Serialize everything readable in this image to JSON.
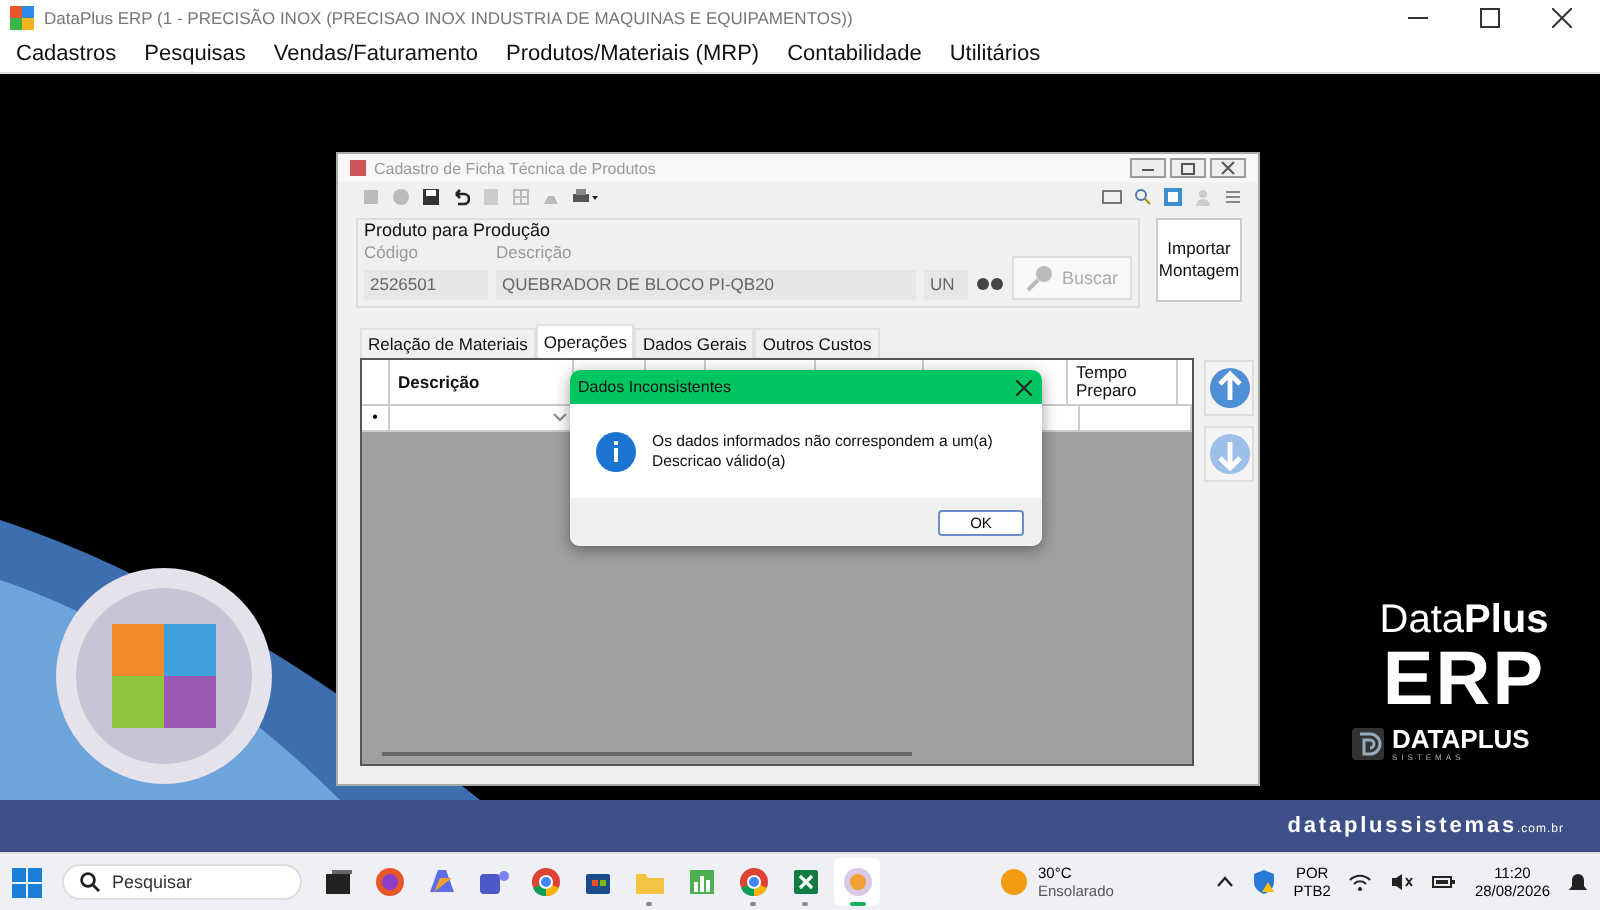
{
  "app_window": {
    "title": "DataPlus ERP (1 - PRECISÃO INOX  (PRECISAO INOX INDUSTRIA DE MAQUINAS E EQUIPAMENTOS))"
  },
  "menu": [
    "Cadastros",
    "Pesquisas",
    "Vendas/Faturamento",
    "Produtos/Materiais (MRP)",
    "Contabilidade",
    "Utilitários"
  ],
  "child_window": {
    "title": "Cadastro de Ficha Técnica de Produtos",
    "group_title": "Produto para Produção",
    "fields": [
      {
        "label": "Código",
        "value": "2526501"
      },
      {
        "label": "Descrição",
        "value": "QUEBRADOR DE BLOCO PI-QB20"
      }
    ],
    "unit": "UN",
    "search_button": {
      "label": "Buscar",
      "disabled": true
    },
    "import_button": "Importar Montagem",
    "tabs": [
      {
        "label": "Relação de Materiais",
        "selected": false
      },
      {
        "label": "Operações",
        "selected": true
      },
      {
        "label": "Dados Gerais",
        "selected": false
      },
      {
        "label": "Outros Custos",
        "selected": false
      }
    ],
    "grid": {
      "columns": [
        "Descrição",
        "Tempo Preparo"
      ],
      "new_row_marker": "•"
    }
  },
  "dialog": {
    "title": "Dados Inconsistentes",
    "message": "Os dados informados não correspondem a um(a) Descricao válido(a)",
    "button": "OK"
  },
  "branding": {
    "product_light": "Data",
    "product_bold": "Plus",
    "product_line2": "ERP",
    "company": "DATAPLUS",
    "company_sub": "SISTEMAS",
    "website": "dataplussistemas",
    "website_suffix": ".com.br"
  },
  "taskbar": {
    "search_placeholder": "Pesquisar",
    "apps": [
      {
        "kind": "task-view",
        "running": false,
        "selected": false
      },
      {
        "kind": "firefox",
        "running": false,
        "selected": false
      },
      {
        "kind": "copilot",
        "running": false,
        "selected": false
      },
      {
        "kind": "teams",
        "running": false,
        "selected": false
      },
      {
        "kind": "chrome",
        "running": false,
        "selected": false
      },
      {
        "kind": "store",
        "running": false,
        "selected": false
      },
      {
        "kind": "folder",
        "running": true,
        "selected": false
      },
      {
        "kind": "chart",
        "running": false,
        "selected": false
      },
      {
        "kind": "chrome",
        "running": true,
        "selected": false
      },
      {
        "kind": "excel",
        "running": true,
        "selected": false
      },
      {
        "kind": "dataplus",
        "running": true,
        "selected": true
      }
    ],
    "weather": {
      "temperature": "30°C",
      "condition": "Ensolarado"
    },
    "language": "POR",
    "layout": "PTB2",
    "time": "11:20",
    "date": "28/08/2026"
  }
}
